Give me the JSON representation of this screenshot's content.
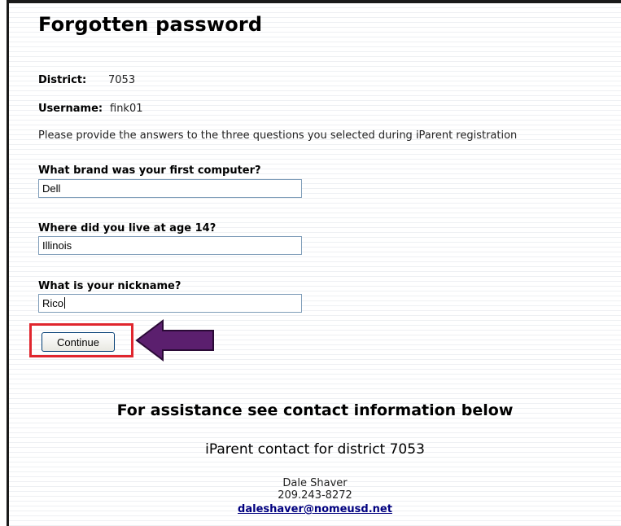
{
  "page": {
    "title": "Forgotten password"
  },
  "account": {
    "district_label": "District:",
    "district_value": "7053",
    "username_label": "Username:",
    "username_value": "fink01"
  },
  "instruction": "Please provide the answers to the three questions you selected during iParent registration",
  "questions": [
    {
      "label": "What brand was your first computer?",
      "value": "Dell"
    },
    {
      "label": "Where did you live at age 14?",
      "value": "Illinois"
    },
    {
      "label": "What is your nickname?",
      "value": "Rico"
    }
  ],
  "actions": {
    "continue_label": "Continue"
  },
  "annotation": {
    "highlight_color": "#e0262e",
    "arrow_color": "#5b1f6e"
  },
  "assistance": {
    "heading": "For assistance see contact information below",
    "contact_title": "iParent contact for district 7053",
    "name": "Dale Shaver",
    "phone": "209.243-8272",
    "email": "daleshaver@nomeusd.net"
  }
}
